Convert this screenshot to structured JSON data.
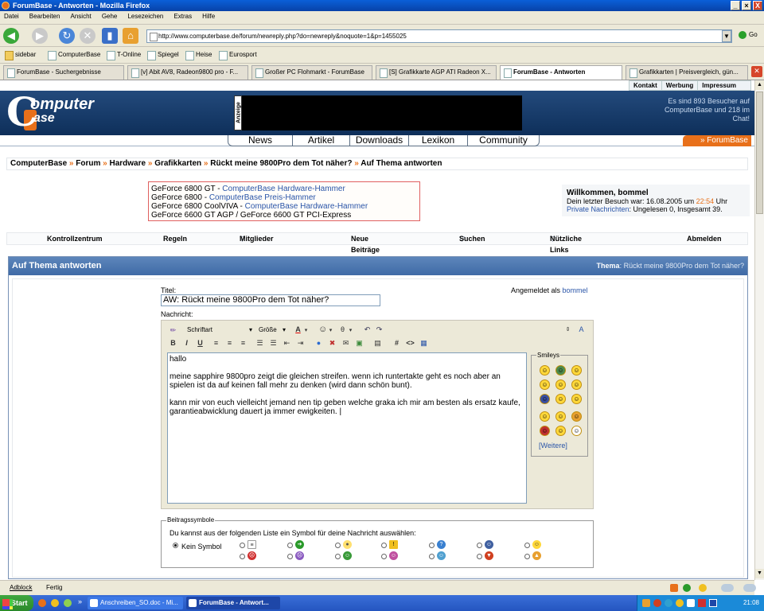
{
  "window": {
    "title": "ForumBase - Antworten - Mozilla Firefox",
    "minimize": "_",
    "maximize": "×",
    "close": "X"
  },
  "menu": [
    "Datei",
    "Bearbeiten",
    "Ansicht",
    "Gehe",
    "Lesezeichen",
    "Extras",
    "Hilfe"
  ],
  "address": {
    "url": "http://www.computerbase.de/forum/newreply.php?do=newreply&noquote=1&p=1455025",
    "go": "Go"
  },
  "bookmarks": [
    "sidebar",
    "ComputerBase",
    "T-Online",
    "Spiegel",
    "Heise",
    "Eurosport"
  ],
  "tabs": [
    "ForumBase - Suchergebnisse",
    "[v] Abit AV8, Radeon9800 pro - F...",
    "Großer PC Flohmarkt - ForumBase",
    "[S] Grafikkarte AGP ATI Radeon X...",
    "ForumBase - Antworten",
    "Grafikkarten | Preisvergleich, gün..."
  ],
  "topnav": [
    "Kontakt",
    "Werbung",
    "Impressum"
  ],
  "logo": {
    "line1": "omputer",
    "line2": "ase",
    "c": "C"
  },
  "ad_label": "Anzeige",
  "visitors": "Es sind 893 Besucher auf ComputerBase und 218 im Chat!",
  "mainnav": [
    "News",
    "Artikel",
    "Downloads",
    "Lexikon",
    "Community"
  ],
  "forumbase_tab": "» ForumBase",
  "breadcrumb": [
    "ComputerBase",
    "Forum",
    "Hardware",
    "Grafikkarten",
    "Rückt meine 9800Pro dem Tot näher?",
    "Auf Thema antworten"
  ],
  "breadcrumb_sep": "»",
  "adlinks": [
    {
      "text": "GeForce 6800 GT - ",
      "link": "ComputerBase Hardware-Hammer"
    },
    {
      "text": "GeForce 6800 - ",
      "link": "ComputerBase Preis-Hammer"
    },
    {
      "text": "GeForce 6800 CoolVIVA - ",
      "link": "ComputerBase Hardware-Hammer"
    },
    {
      "text": "GeForce 6600 GT AGP / GeForce 6600 GT PCI-Express",
      "link": ""
    }
  ],
  "welcome": {
    "title": "Willkommen, bommel",
    "last_visit_prefix": "Dein letzter Besuch war: 16.08.2005 um ",
    "last_visit_time": "22:54",
    "last_visit_suffix": " Uhr",
    "pm_link": "Private Nachrichten",
    "pm_text": ": Ungelesen 0, Insgesamt 39."
  },
  "menurow": [
    {
      "label": "Kontrollzentrum",
      "arrow": ""
    },
    {
      "label": "Regeln",
      "arrow": ""
    },
    {
      "label": "Mitglieder",
      "arrow": "▽"
    },
    {
      "label": "Neue Beiträge",
      "arrow": ""
    },
    {
      "label": "Suchen",
      "arrow": "▽"
    },
    {
      "label": "Nützliche Links",
      "arrow": "▽"
    },
    {
      "label": "Abmelden",
      "arrow": ""
    }
  ],
  "panel": {
    "title": "Auf Thema antworten",
    "thema_label": "Thema",
    "thema_value": ": Rückt meine 9800Pro dem Tot näher?"
  },
  "form": {
    "titel_label": "Titel:",
    "titel_value": "AW: Rückt meine 9800Pro dem Tot näher?",
    "nachricht_label": "Nachricht:",
    "logged_in_prefix": "Angemeldet als ",
    "logged_in_user": "bommel"
  },
  "editor": {
    "font": "Schriftart",
    "size": "Größe",
    "bold": "B",
    "italic": "I",
    "underline": "U",
    "message": "hallo\n\nmeine sapphire 9800pro zeigt die gleichen streifen. wenn ich runtertakte geht es noch aber an spielen ist da auf keinen fall mehr zu denken (wird dann schön bunt).\n\nkann mir von euch vielleicht jemand nen tip geben welche graka ich mir am besten als ersatz kaufe, garantieabwicklung dauert ja immer ewigkeiten. |"
  },
  "smileys": {
    "legend": "Smileys",
    "more": "[Weitere]"
  },
  "symbols": {
    "legend": "Beitragssymbole",
    "intro": "Du kannst aus der folgenden Liste ein Symbol für deine Nachricht auswählen:",
    "none": "Kein Symbol"
  },
  "status": {
    "adblock": "Adblock",
    "text": "Fertig"
  },
  "taskbar": {
    "start": "Start",
    "tasks": [
      "Anschreiben_SO.doc - Mi...",
      "ForumBase - Antwort..."
    ],
    "clock": "21:08"
  },
  "colors": {
    "accent_orange": "#e8701a",
    "header_blue": "#1b3f6e",
    "link_blue": "#2a55a8"
  }
}
